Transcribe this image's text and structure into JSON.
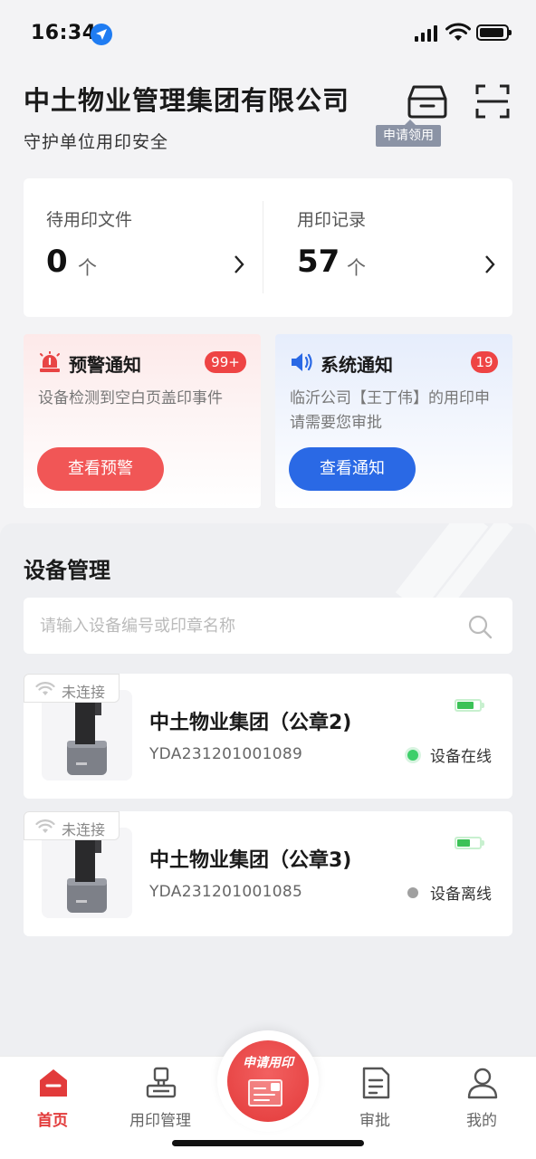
{
  "status_bar": {
    "time": "16:34"
  },
  "header": {
    "company_name": "中土物业管理集团有限公司",
    "tagline": "守护单位用印安全",
    "apply_tooltip": "申请领用"
  },
  "stats": {
    "pending": {
      "label": "待用印文件",
      "value": "0",
      "unit": "个"
    },
    "records": {
      "label": "用印记录",
      "value": "57",
      "unit": "个"
    }
  },
  "notices": {
    "warning": {
      "title": "预警通知",
      "badge": "99+",
      "description": "设备检测到空白页盖印事件",
      "button": "查看预警",
      "color": "#f15656"
    },
    "system": {
      "title": "系统通知",
      "badge": "19",
      "description": "临沂公司【王丁伟】的用印申请需要您审批",
      "button": "查看通知",
      "color": "#2a69e5"
    }
  },
  "device_section": {
    "title": "设备管理",
    "search_placeholder": "请输入设备编号或印章名称",
    "devices": [
      {
        "name": "中土物业集团（公章2)",
        "code": "YDA231201001089",
        "connection": "未连接",
        "status": "设备在线",
        "online": true,
        "battery_level": 0.75
      },
      {
        "name": "中土物业集团（公章3)",
        "code": "YDA231201001085",
        "connection": "未连接",
        "status": "设备离线",
        "online": false,
        "battery_level": 0.6
      }
    ]
  },
  "tab_bar": {
    "home": "首页",
    "seal_management": "用印管理",
    "apply_seal": "申请用印",
    "approval": "审批",
    "mine": "我的",
    "active": "home",
    "accent_color": "#e23b3b"
  }
}
